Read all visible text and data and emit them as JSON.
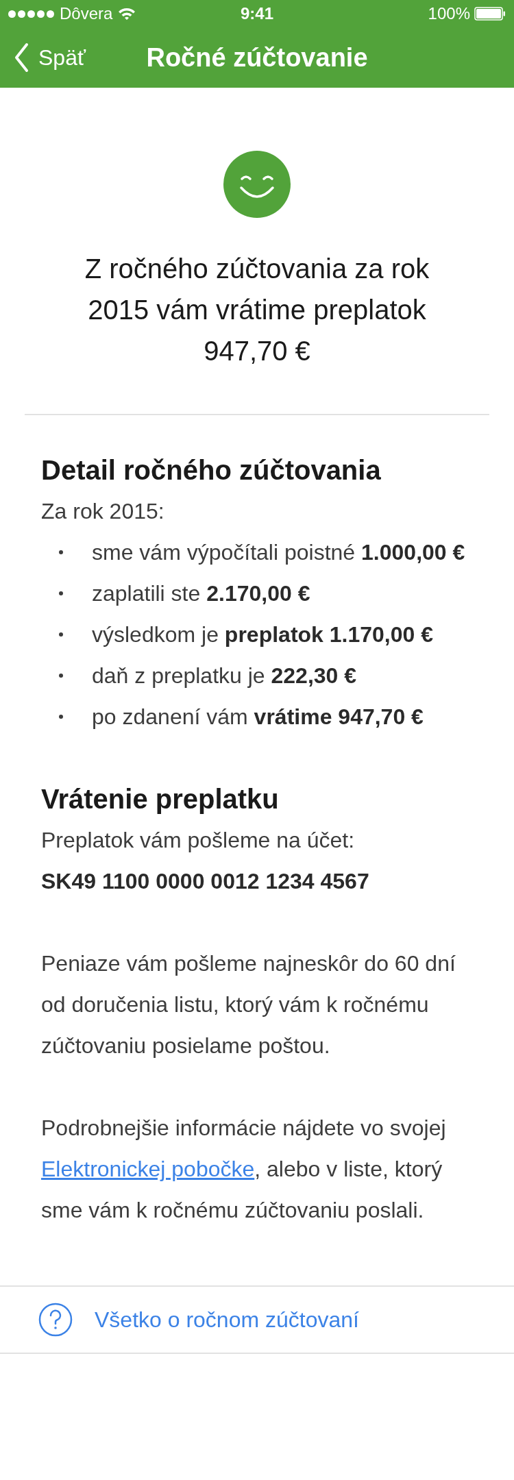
{
  "status_bar": {
    "carrier": "Dôvera",
    "time": "9:41",
    "battery": "100%"
  },
  "nav": {
    "back": "Späť",
    "title": "Ročné zúčtovanie"
  },
  "headline": "Z ročného zúčtovania za rok 2015 vám vrátime preplatok 947,70 €",
  "detail": {
    "heading": "Detail ročného zúčtovania",
    "intro": "Za rok 2015:",
    "items": [
      "sme vám výpočítali poistné **1.000,00 €**",
      "zaplatili ste **2.170,00 €**",
      "výsledkom je **preplatok 1.170,00 €**",
      "daň z preplatku je **222,30 €**",
      "po zdanení vám **vrátime 947,70 €**"
    ]
  },
  "refund": {
    "heading": "Vrátenie preplatku",
    "account_label": "Preplatok vám pošleme na účet:",
    "account": "SK49 1100 0000 0012 1234 4567",
    "note": "Peniaze vám pošleme najneskôr do 60 dní od doručenia listu, ktorý vám k ročnému zúčtovaniu posielame poštou.",
    "info": {
      "before": "Podrobnejšie informácie nájdete vo svojej ",
      "link": "Elektronickej pobočke",
      "after": ", alebo v liste, ktorý sme vám k ročnému zúčtovaniu poslali."
    }
  },
  "help_link": "Všetko o ročnom zúčtovaní"
}
